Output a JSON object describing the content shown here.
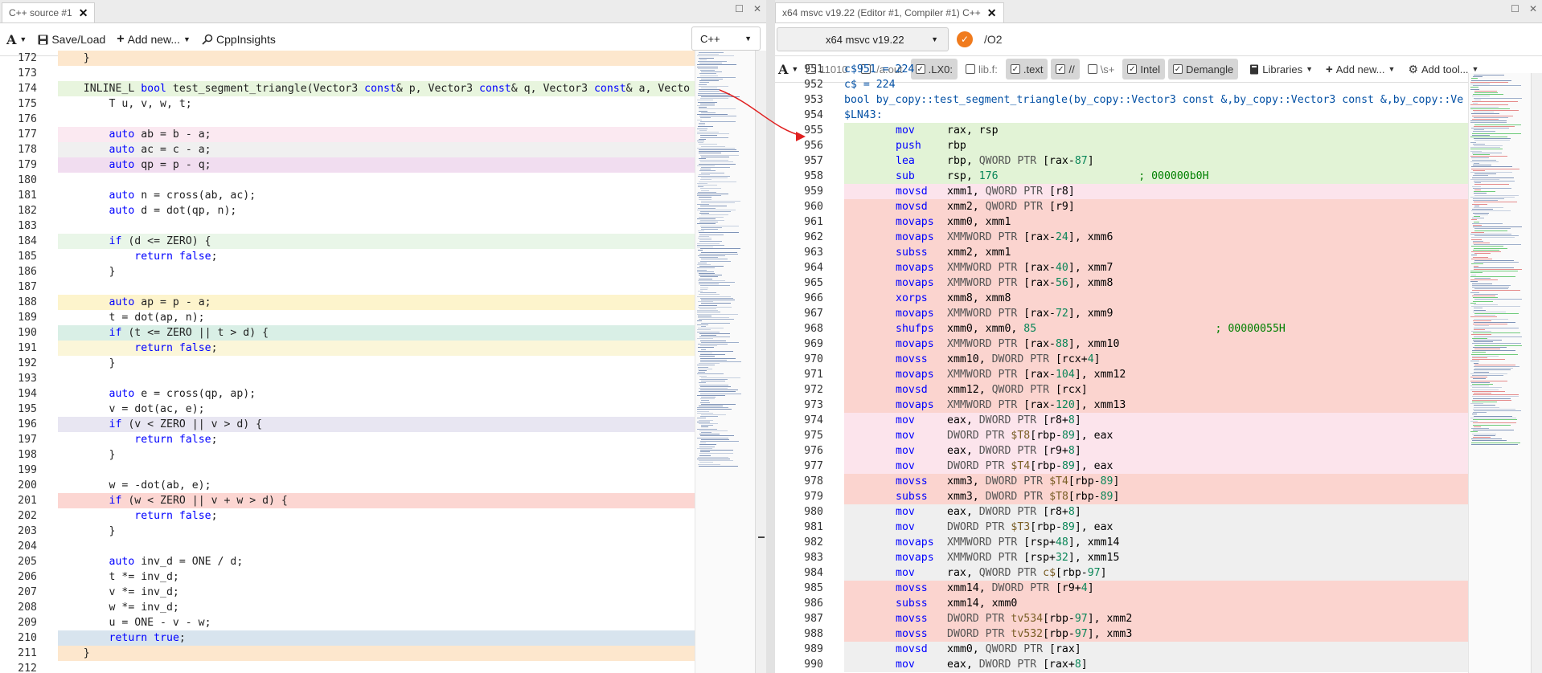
{
  "left_pane": {
    "tab_title": "C++ source #1",
    "close_glyph": "✕",
    "window_buttons": [
      "☐",
      "✕"
    ],
    "toolbar": {
      "font_label": "A",
      "save_load": "Save/Load",
      "add_new": "Add new...",
      "cpp_insights": "CppInsights",
      "language": "C++"
    },
    "lines": [
      {
        "n": "172",
        "t": "    }"
      },
      {
        "n": "173",
        "t": ""
      },
      {
        "n": "174",
        "t": "    INLINE_L bool test_segment_triangle(Vector3 const& p, Vector3 const& q, Vector3 const& a, Vecto"
      },
      {
        "n": "175",
        "t": "        T u, v, w, t;"
      },
      {
        "n": "176",
        "t": ""
      },
      {
        "n": "177",
        "t": "        auto ab = b - a;"
      },
      {
        "n": "178",
        "t": "        auto ac = c - a;"
      },
      {
        "n": "179",
        "t": "        auto qp = p - q;"
      },
      {
        "n": "180",
        "t": ""
      },
      {
        "n": "181",
        "t": "        auto n = cross(ab, ac);"
      },
      {
        "n": "182",
        "t": "        auto d = dot(qp, n);"
      },
      {
        "n": "183",
        "t": ""
      },
      {
        "n": "184",
        "t": "        if (d <= ZERO) {"
      },
      {
        "n": "185",
        "t": "            return false;"
      },
      {
        "n": "186",
        "t": "        }"
      },
      {
        "n": "187",
        "t": ""
      },
      {
        "n": "188",
        "t": "        auto ap = p - a;"
      },
      {
        "n": "189",
        "t": "        t = dot(ap, n);"
      },
      {
        "n": "190",
        "t": "        if (t <= ZERO || t > d) {"
      },
      {
        "n": "191",
        "t": "            return false;"
      },
      {
        "n": "192",
        "t": "        }"
      },
      {
        "n": "193",
        "t": ""
      },
      {
        "n": "194",
        "t": "        auto e = cross(qp, ap);"
      },
      {
        "n": "195",
        "t": "        v = dot(ac, e);"
      },
      {
        "n": "196",
        "t": "        if (v < ZERO || v > d) {"
      },
      {
        "n": "197",
        "t": "            return false;"
      },
      {
        "n": "198",
        "t": "        }"
      },
      {
        "n": "199",
        "t": ""
      },
      {
        "n": "200",
        "t": "        w = -dot(ab, e);"
      },
      {
        "n": "201",
        "t": "        if (w < ZERO || v + w > d) {"
      },
      {
        "n": "202",
        "t": "            return false;"
      },
      {
        "n": "203",
        "t": "        }"
      },
      {
        "n": "204",
        "t": ""
      },
      {
        "n": "205",
        "t": "        auto inv_d = ONE / d;"
      },
      {
        "n": "206",
        "t": "        t *= inv_d;"
      },
      {
        "n": "207",
        "t": "        v *= inv_d;"
      },
      {
        "n": "208",
        "t": "        w *= inv_d;"
      },
      {
        "n": "209",
        "t": "        u = ONE - v - w;"
      },
      {
        "n": "210",
        "t": "        return true;"
      },
      {
        "n": "211",
        "t": "    }"
      },
      {
        "n": "212",
        "t": ""
      }
    ],
    "line_colors": [
      "#fde7cd",
      "",
      "#e8f5de",
      "",
      "",
      "#fbe9f1",
      "#f0f0f0",
      "#f1ddf0",
      "",
      "",
      "",
      "",
      "#e9f6e8",
      "",
      "",
      "",
      "#fdf4cc",
      "",
      "#d9efe6",
      "#fbf6d9",
      "",
      "",
      "",
      "",
      "#e8e6f2",
      "",
      "",
      "",
      "",
      "#fcd6d2",
      "",
      "",
      "",
      "",
      "",
      "",
      "",
      "",
      "#d8e4ee",
      "#fde7cd",
      ""
    ]
  },
  "right_pane": {
    "tab_title": "x64 msvc v19.22 (Editor #1, Compiler #1) C++",
    "close_glyph": "✕",
    "window_buttons": [
      "☐",
      "✕"
    ],
    "compiler": "x64 msvc v19.22",
    "options": "/O2",
    "filters": [
      {
        "label": "11010",
        "checked": false
      },
      {
        "label": "./a.out",
        "checked": false
      },
      {
        "label": ".LX0:",
        "checked": true
      },
      {
        "label": "lib.f:",
        "checked": false
      },
      {
        "label": ".text",
        "checked": true
      },
      {
        "label": "//",
        "checked": true
      },
      {
        "label": "\\s+",
        "checked": false
      },
      {
        "label": "Intel",
        "checked": true
      },
      {
        "label": "Demangle",
        "checked": true
      }
    ],
    "libraries": "Libraries",
    "add_new": "Add new...",
    "add_tool": "Add tool...",
    "font_label": "A",
    "check_glyph": "✓",
    "lines": [
      {
        "n": "951",
        "op": "",
        "args": "c$951 = 224"
      },
      {
        "n": "952",
        "op": "",
        "args": "c$ = 224"
      },
      {
        "n": "953",
        "op": "",
        "args": "bool by_copy::test_segment_triangle(by_copy::Vector3 const &,by_copy::Vector3 const &,by_copy::Ve"
      },
      {
        "n": "954",
        "op": "",
        "args": "$LN43:"
      },
      {
        "n": "955",
        "op": "mov",
        "args": "rax, rsp"
      },
      {
        "n": "956",
        "op": "push",
        "args": "rbp"
      },
      {
        "n": "957",
        "op": "lea",
        "args": "rbp, QWORD PTR [rax-87]"
      },
      {
        "n": "958",
        "op": "sub",
        "args": "rsp, 176                      ; 000000b0H"
      },
      {
        "n": "959",
        "op": "movsd",
        "args": "xmm1, QWORD PTR [r8]"
      },
      {
        "n": "960",
        "op": "movsd",
        "args": "xmm2, QWORD PTR [r9]"
      },
      {
        "n": "961",
        "op": "movaps",
        "args": "xmm0, xmm1"
      },
      {
        "n": "962",
        "op": "movaps",
        "args": "XMMWORD PTR [rax-24], xmm6"
      },
      {
        "n": "963",
        "op": "subss",
        "args": "xmm2, xmm1"
      },
      {
        "n": "964",
        "op": "movaps",
        "args": "XMMWORD PTR [rax-40], xmm7"
      },
      {
        "n": "965",
        "op": "movaps",
        "args": "XMMWORD PTR [rax-56], xmm8"
      },
      {
        "n": "966",
        "op": "xorps",
        "args": "xmm8, xmm8"
      },
      {
        "n": "967",
        "op": "movaps",
        "args": "XMMWORD PTR [rax-72], xmm9"
      },
      {
        "n": "968",
        "op": "shufps",
        "args": "xmm0, xmm0, 85                            ; 00000055H"
      },
      {
        "n": "969",
        "op": "movaps",
        "args": "XMMWORD PTR [rax-88], xmm10"
      },
      {
        "n": "970",
        "op": "movss",
        "args": "xmm10, DWORD PTR [rcx+4]"
      },
      {
        "n": "971",
        "op": "movaps",
        "args": "XMMWORD PTR [rax-104], xmm12"
      },
      {
        "n": "972",
        "op": "movsd",
        "args": "xmm12, QWORD PTR [rcx]"
      },
      {
        "n": "973",
        "op": "movaps",
        "args": "XMMWORD PTR [rax-120], xmm13"
      },
      {
        "n": "974",
        "op": "mov",
        "args": "eax, DWORD PTR [r8+8]"
      },
      {
        "n": "975",
        "op": "mov",
        "args": "DWORD PTR $T8[rbp-89], eax"
      },
      {
        "n": "976",
        "op": "mov",
        "args": "eax, DWORD PTR [r9+8]"
      },
      {
        "n": "977",
        "op": "mov",
        "args": "DWORD PTR $T4[rbp-89], eax"
      },
      {
        "n": "978",
        "op": "movss",
        "args": "xmm3, DWORD PTR $T4[rbp-89]"
      },
      {
        "n": "979",
        "op": "subss",
        "args": "xmm3, DWORD PTR $T8[rbp-89]"
      },
      {
        "n": "980",
        "op": "mov",
        "args": "eax, DWORD PTR [r8+8]"
      },
      {
        "n": "981",
        "op": "mov",
        "args": "DWORD PTR $T3[rbp-89], eax"
      },
      {
        "n": "982",
        "op": "movaps",
        "args": "XMMWORD PTR [rsp+48], xmm14"
      },
      {
        "n": "983",
        "op": "movaps",
        "args": "XMMWORD PTR [rsp+32], xmm15"
      },
      {
        "n": "984",
        "op": "mov",
        "args": "rax, QWORD PTR c$[rbp-97]"
      },
      {
        "n": "985",
        "op": "movss",
        "args": "xmm14, DWORD PTR [r9+4]"
      },
      {
        "n": "986",
        "op": "subss",
        "args": "xmm14, xmm0"
      },
      {
        "n": "987",
        "op": "movss",
        "args": "DWORD PTR tv534[rbp-97], xmm2"
      },
      {
        "n": "988",
        "op": "movss",
        "args": "DWORD PTR tv532[rbp-97], xmm3"
      },
      {
        "n": "989",
        "op": "movsd",
        "args": "xmm0, QWORD PTR [rax]"
      },
      {
        "n": "990",
        "op": "mov",
        "args": "eax, DWORD PTR [rax+8]"
      }
    ],
    "line_colors": [
      "",
      "",
      "",
      "",
      "#e2f3d6",
      "#e2f3d6",
      "#e2f3d6",
      "#e2f3d6",
      "#fce4ec",
      "#fbd4cf",
      "#fbd4cf",
      "#fbd4cf",
      "#fbd4cf",
      "#fbd4cf",
      "#fbd4cf",
      "#fbd4cf",
      "#fbd4cf",
      "#fbd4cf",
      "#fbd4cf",
      "#fbd4cf",
      "#fbd4cf",
      "#fbd4cf",
      "#fbd4cf",
      "#fce4ec",
      "#fce4ec",
      "#fce4ec",
      "#fce4ec",
      "#fbd4cf",
      "#fbd4cf",
      "#efefef",
      "#efefef",
      "#efefef",
      "#efefef",
      "#efefef",
      "#fbd4cf",
      "#fbd4cf",
      "#fbd4cf",
      "#fbd4cf",
      "#efefef",
      "#efefef"
    ]
  },
  "colors": {
    "keyword": "#0000ff",
    "arrow": "#e02020",
    "number": "#098658",
    "label": "#0451a5"
  }
}
